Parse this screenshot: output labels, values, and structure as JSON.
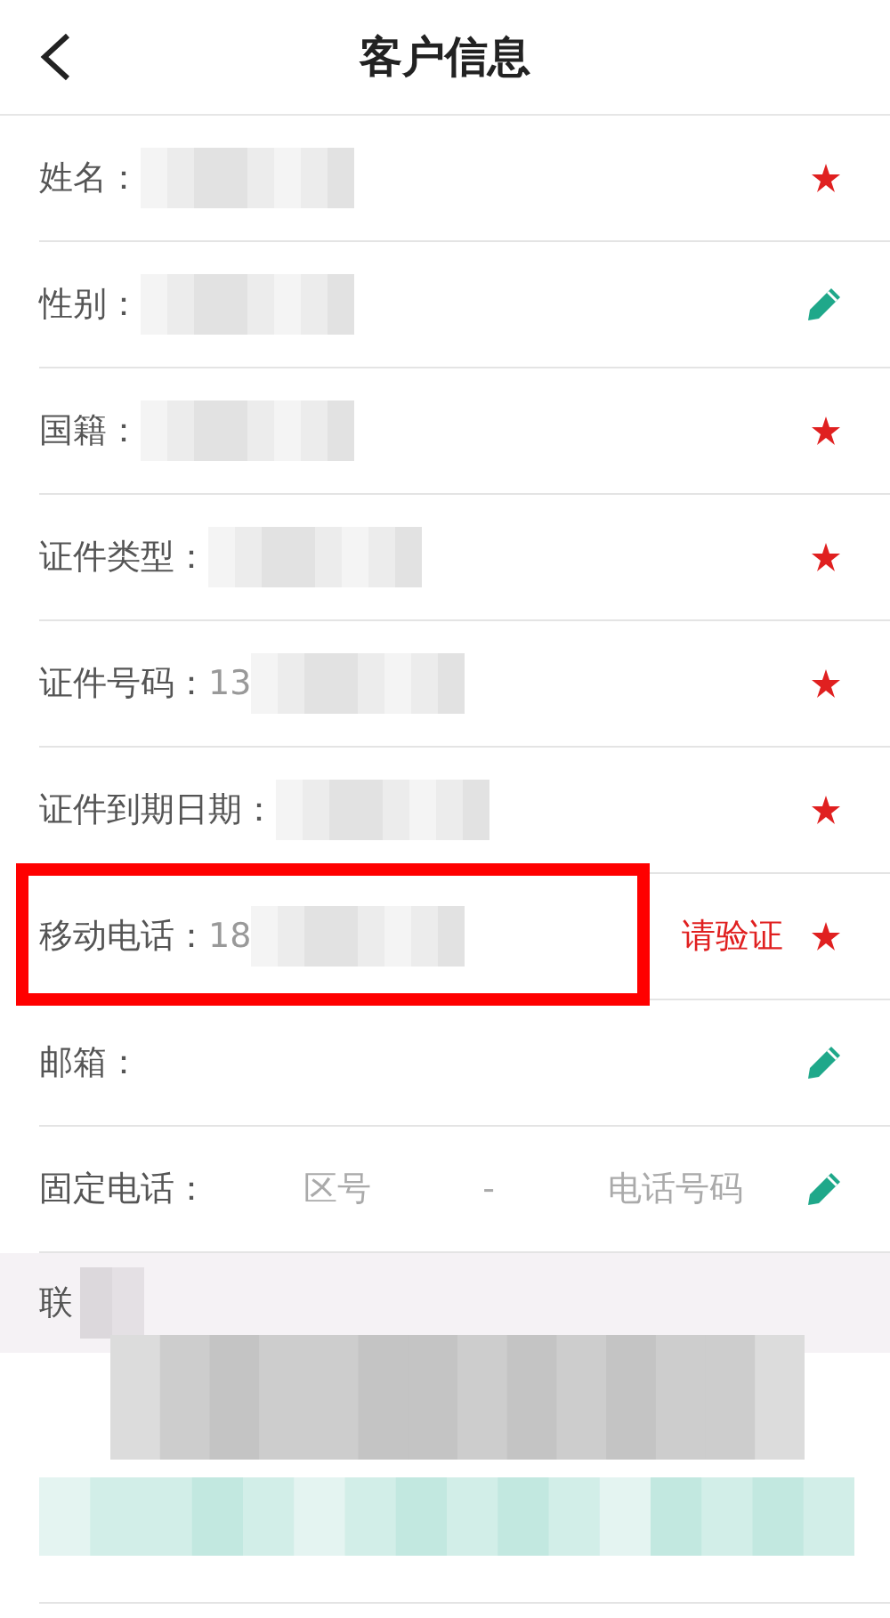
{
  "header": {
    "title": "客户信息"
  },
  "fields": [
    {
      "kind": "text",
      "label": "姓名：",
      "redacted": true,
      "required": true
    },
    {
      "kind": "text",
      "label": "性别：",
      "redacted": true,
      "required": false
    },
    {
      "kind": "text",
      "label": "国籍：",
      "redacted": true,
      "required": true
    },
    {
      "kind": "text",
      "label": "证件类型：",
      "redacted": true,
      "required": true
    },
    {
      "kind": "text",
      "label": "证件号码：",
      "value": "13",
      "redacted": true,
      "required": true
    },
    {
      "kind": "text",
      "label": "证件到期日期：",
      "redacted": true,
      "required": true
    },
    {
      "kind": "text",
      "label": "移动电话：",
      "value": "18",
      "redacted": true,
      "action": "请验证",
      "highlighted": true,
      "required": true
    },
    {
      "kind": "text",
      "label": "邮箱：",
      "required": false
    },
    {
      "kind": "phone_pair",
      "label": "固定电话：",
      "area_placeholder": "区号",
      "separator": "-",
      "number_placeholder": "电话号码",
      "required": false
    }
  ],
  "contact_section": {
    "label": "联",
    "redacted": true
  }
}
